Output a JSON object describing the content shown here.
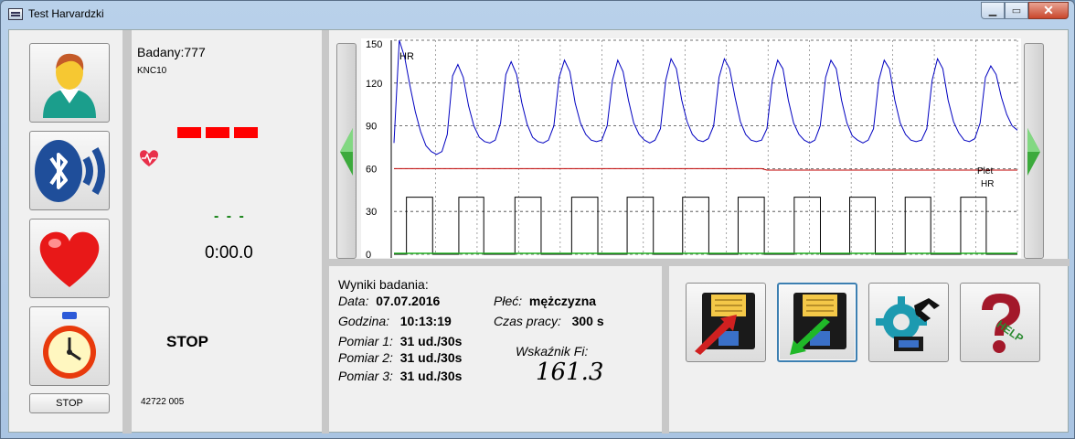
{
  "window": {
    "title": "Test Harvardzki"
  },
  "left_buttons": {
    "user_icon": "user-icon",
    "bluetooth_icon": "bluetooth-icon",
    "heart_icon": "heart-icon",
    "stopwatch_icon": "stopwatch-icon",
    "stop_label": "STOP"
  },
  "info": {
    "badany_label": "Badany:",
    "badany_value": "777",
    "code": "KNC10",
    "rate_display": "- - -",
    "timer": "0:00.0",
    "state": "STOP",
    "serial": "42722 005"
  },
  "chart_data": {
    "type": "line",
    "y_ticks": [
      "150",
      "120",
      "90",
      "60",
      "30",
      "0"
    ],
    "ylim": [
      0,
      150
    ],
    "grid": true,
    "labels": {
      "hr_top": "HR",
      "plet": "Plet",
      "hr_bottom": "HR"
    },
    "series": [
      {
        "name": "HR",
        "color": "#0000c0",
        "values": [
          78,
          150,
          138,
          118,
          100,
          86,
          76,
          72,
          70,
          72,
          84,
          125,
          133,
          124,
          104,
          90,
          82,
          79,
          78,
          80,
          92,
          126,
          135,
          126,
          106,
          91,
          82,
          79,
          78,
          80,
          90,
          124,
          136,
          128,
          106,
          92,
          84,
          80,
          79,
          80,
          90,
          122,
          136,
          128,
          108,
          92,
          84,
          80,
          78,
          80,
          88,
          122,
          137,
          130,
          108,
          93,
          84,
          80,
          79,
          81,
          90,
          124,
          137,
          130,
          110,
          93,
          84,
          80,
          79,
          80,
          88,
          122,
          136,
          130,
          108,
          92,
          84,
          80,
          78,
          80,
          90,
          124,
          136,
          130,
          108,
          92,
          83,
          80,
          78,
          80,
          88,
          122,
          136,
          130,
          108,
          92,
          84,
          80,
          79,
          80,
          88,
          122,
          137,
          130,
          108,
          93,
          85,
          80,
          79,
          81,
          92,
          124,
          132,
          126,
          110,
          98,
          90,
          87
        ]
      },
      {
        "name": "Plet",
        "color": "#c00000",
        "values": [
          60,
          60,
          60,
          60,
          60,
          60,
          60,
          60,
          60,
          60,
          60,
          60,
          60,
          60,
          60,
          60,
          60,
          60,
          60,
          60,
          60,
          60,
          60,
          60,
          60,
          60,
          60,
          60,
          60,
          60,
          60,
          60,
          60,
          60,
          60,
          60,
          60,
          60,
          60,
          60,
          60,
          60,
          60,
          60,
          60,
          60,
          60,
          60,
          60,
          60,
          60,
          60,
          60,
          60,
          60,
          60,
          60,
          60,
          60,
          60,
          60,
          60,
          60,
          60,
          60,
          60,
          60,
          60,
          60,
          60,
          59,
          59,
          59,
          59,
          59,
          59,
          59,
          59,
          59,
          59,
          59,
          59,
          59,
          59,
          59,
          59,
          59,
          59,
          59,
          59,
          59,
          59,
          59,
          59,
          59,
          59,
          59,
          59,
          59,
          59,
          59,
          59,
          59,
          59,
          59,
          59,
          59,
          59,
          59,
          59,
          59,
          59,
          59,
          59,
          59,
          59,
          59,
          59
        ]
      },
      {
        "name": "pulse",
        "color": "#000000",
        "pulses": [
          [
            0.02,
            0.062
          ],
          [
            0.104,
            0.144
          ],
          [
            0.194,
            0.236
          ],
          [
            0.285,
            0.327
          ],
          [
            0.374,
            0.416
          ],
          [
            0.463,
            0.505
          ],
          [
            0.552,
            0.594
          ],
          [
            0.642,
            0.684
          ],
          [
            0.731,
            0.772
          ],
          [
            0.82,
            0.861
          ],
          [
            0.909,
            0.95
          ]
        ],
        "high": 40
      }
    ]
  },
  "results": {
    "heading": "Wyniki badania:",
    "data_label": "Data:",
    "data_value": "07.07.2016",
    "godzina_label": "Godzina:",
    "godzina_value": "10:13:19",
    "pomiar1_label": "Pomiar 1:",
    "pomiar1_value": "31 ud./30s",
    "pomiar2_label": "Pomiar 2:",
    "pomiar2_value": "31 ud./30s",
    "pomiar3_label": "Pomiar 3:",
    "pomiar3_value": "31 ud./30s",
    "plec_label": "Płeć:",
    "plec_value": "mężczyzna",
    "czas_label": "Czas pracy:",
    "czas_value": "300 s",
    "wskaznik_label": "Wskaźnik Fi:",
    "wskaznik_value": "161.3"
  },
  "actions": {
    "export_icon": "floppy-export-icon",
    "import_icon": "floppy-import-icon",
    "settings_icon": "settings-icon",
    "help_icon": "help-icon",
    "help_text": "HELP"
  }
}
